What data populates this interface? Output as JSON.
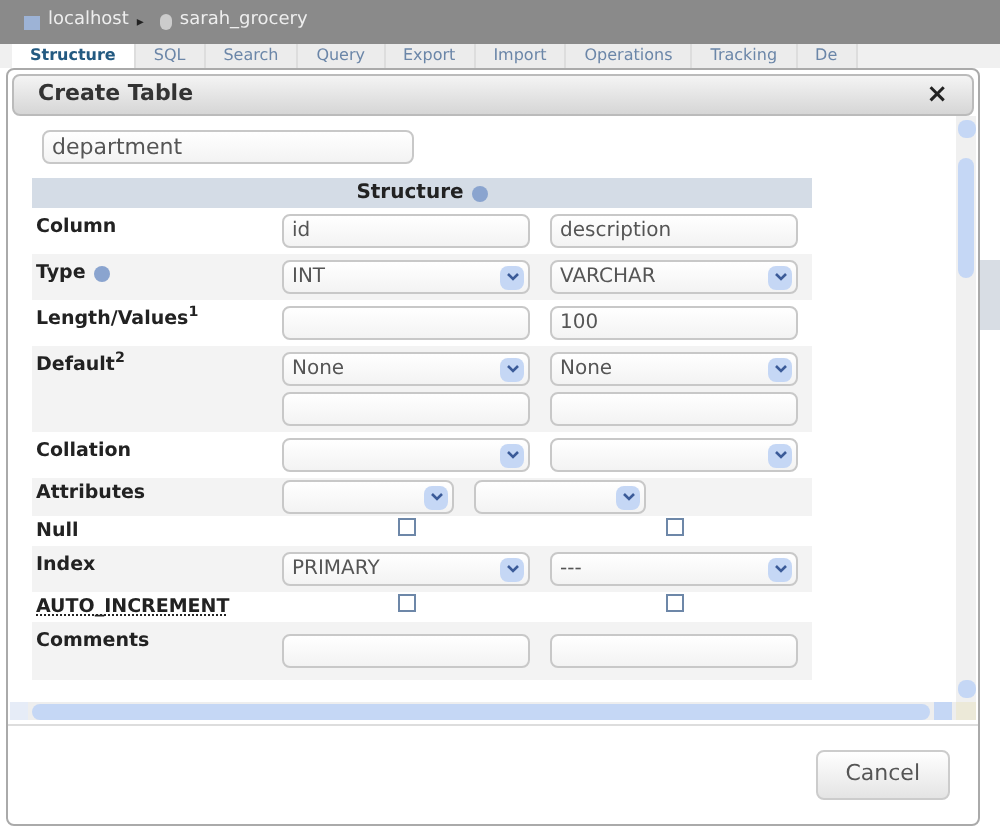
{
  "breadcrumb": {
    "server": "localhost",
    "separator": "▸",
    "database": "sarah_grocery"
  },
  "tabs": [
    {
      "label": "Structure",
      "selected": true
    },
    {
      "label": "SQL",
      "selected": false
    },
    {
      "label": "Search",
      "selected": false
    },
    {
      "label": "Query",
      "selected": false
    },
    {
      "label": "Export",
      "selected": false
    },
    {
      "label": "Import",
      "selected": false
    },
    {
      "label": "Operations",
      "selected": false
    },
    {
      "label": "Tracking",
      "selected": false
    },
    {
      "label": "De",
      "selected": false
    }
  ],
  "dialog": {
    "title": "Create Table",
    "close": "×",
    "table_name": {
      "value": "department"
    },
    "structure_header": "Structure",
    "rows": [
      {
        "label": "Column",
        "kind": "input",
        "cells": [
          {
            "value": "id"
          },
          {
            "value": "description"
          }
        ]
      },
      {
        "label": "Type",
        "kind": "select",
        "help": true,
        "cells": [
          {
            "value": "INT"
          },
          {
            "value": "VARCHAR"
          }
        ]
      },
      {
        "label": "Length/Values$^{1}$",
        "kind": "input",
        "cells": [
          {},
          {
            "value": "100"
          }
        ]
      },
      {
        "label": "Default$^{2}$",
        "kind": "default",
        "cells": [
          {
            "value": "None"
          },
          {
            "value": "None"
          }
        ]
      },
      {
        "label": "Collation",
        "kind": "select",
        "cells": [
          {},
          {}
        ]
      },
      {
        "label": "Attributes",
        "kind": "select_small",
        "cells": [
          {},
          {}
        ]
      },
      {
        "label": "Null",
        "kind": "checkbox",
        "cells": [
          {
            "checked": false
          },
          {
            "checked": false
          }
        ]
      },
      {
        "label": "Index",
        "kind": "select",
        "cells": [
          {
            "value": "PRIMARY"
          },
          {
            "value": "---"
          }
        ]
      },
      {
        "label": "AUTO_INCREMENT",
        "kind": "checkbox",
        "underlined": true,
        "cells": [
          {
            "checked": false
          },
          {
            "checked": false
          }
        ]
      },
      {
        "label": "Comments",
        "kind": "input",
        "cells": [
          {},
          {}
        ]
      }
    ],
    "buttons": [
      "Cancel"
    ]
  }
}
